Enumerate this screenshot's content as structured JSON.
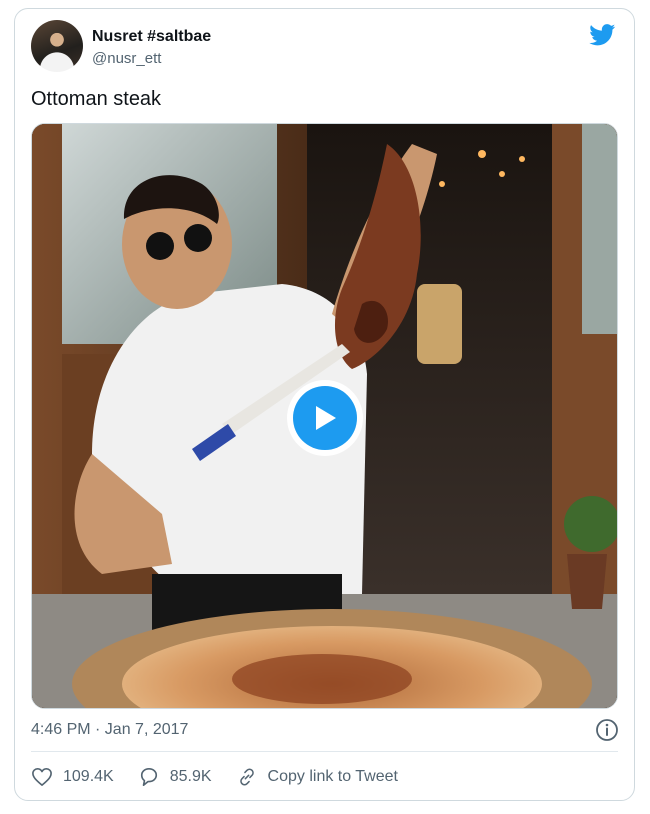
{
  "tweet": {
    "author_name": "Nusret #saltbae",
    "author_handle": "@nusr_ett",
    "text": "Ottoman steak",
    "timestamp": "4:46 PM · Jan 7, 2017",
    "likes": "109.4K",
    "replies": "85.9K",
    "copy_link_label": "Copy link to Tweet"
  },
  "icons": {
    "brand": "twitter-bird-icon",
    "play": "play-icon",
    "info": "info-icon",
    "like": "heart-icon",
    "reply": "reply-bubble-icon",
    "link": "link-icon"
  },
  "colors": {
    "accent": "#1d9bf0",
    "text_primary": "#0f1419",
    "text_secondary": "#536471",
    "border": "#cfd9de"
  }
}
